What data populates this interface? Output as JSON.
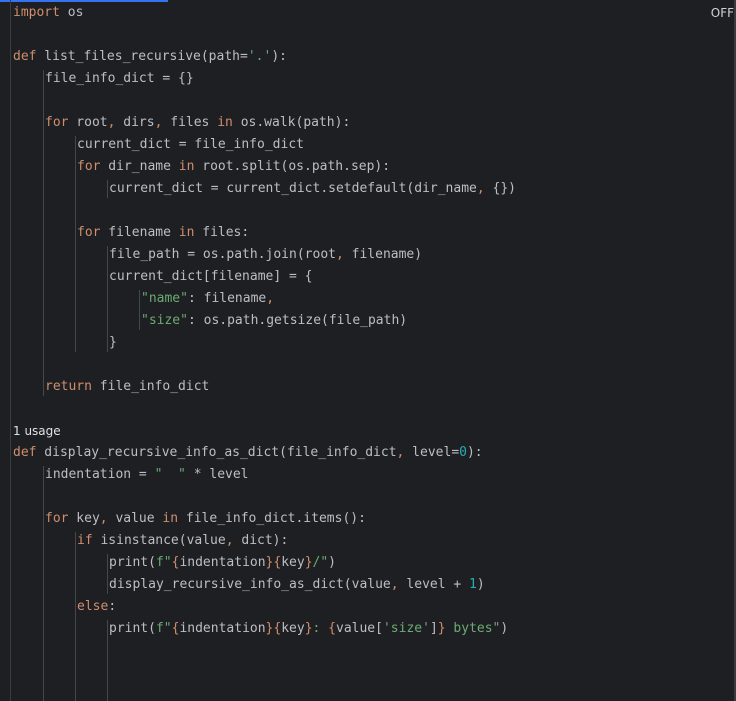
{
  "editor": {
    "badge": "OFF",
    "usage_hint": "1 usage"
  },
  "lines": [
    {
      "indent": 0,
      "tokens": [
        {
          "t": "import",
          "c": "kw"
        },
        {
          "t": " os",
          "c": "plain"
        }
      ]
    },
    {
      "indent": 0,
      "tokens": []
    },
    {
      "indent": 0,
      "tokens": [
        {
          "t": "def",
          "c": "kw"
        },
        {
          "t": " list_files_recursive",
          "c": "plain"
        },
        {
          "t": "(path=",
          "c": "plain"
        },
        {
          "t": "'.'",
          "c": "str"
        },
        {
          "t": "):",
          "c": "plain"
        }
      ]
    },
    {
      "indent": 1,
      "tokens": [
        {
          "t": "file_info_dict = {}",
          "c": "plain"
        }
      ]
    },
    {
      "indent": 0,
      "tokens": []
    },
    {
      "indent": 1,
      "tokens": [
        {
          "t": "for",
          "c": "kw"
        },
        {
          "t": " root",
          "c": "plain"
        },
        {
          "t": ",",
          "c": "kw"
        },
        {
          "t": " dirs",
          "c": "plain"
        },
        {
          "t": ",",
          "c": "kw"
        },
        {
          "t": " files ",
          "c": "plain"
        },
        {
          "t": "in",
          "c": "kw"
        },
        {
          "t": " os.walk(path):",
          "c": "plain"
        }
      ]
    },
    {
      "indent": 2,
      "tokens": [
        {
          "t": "current_dict = file_info_dict",
          "c": "plain"
        }
      ]
    },
    {
      "indent": 2,
      "tokens": [
        {
          "t": "for",
          "c": "kw"
        },
        {
          "t": " dir_name ",
          "c": "plain"
        },
        {
          "t": "in",
          "c": "kw"
        },
        {
          "t": " root.split(os.path.sep):",
          "c": "plain"
        }
      ]
    },
    {
      "indent": 3,
      "tokens": [
        {
          "t": "current_dict = current_dict.setdefault(dir_name",
          "c": "plain"
        },
        {
          "t": ",",
          "c": "kw"
        },
        {
          "t": " {})",
          "c": "plain"
        }
      ]
    },
    {
      "indent": 0,
      "tokens": []
    },
    {
      "indent": 2,
      "tokens": [
        {
          "t": "for",
          "c": "kw"
        },
        {
          "t": " filename ",
          "c": "plain"
        },
        {
          "t": "in",
          "c": "kw"
        },
        {
          "t": " files:",
          "c": "plain"
        }
      ]
    },
    {
      "indent": 3,
      "tokens": [
        {
          "t": "file_path = os.path.join(root",
          "c": "plain"
        },
        {
          "t": ",",
          "c": "kw"
        },
        {
          "t": " filename)",
          "c": "plain"
        }
      ]
    },
    {
      "indent": 3,
      "tokens": [
        {
          "t": "current_dict[filename] = {",
          "c": "plain"
        }
      ]
    },
    {
      "indent": 4,
      "tokens": [
        {
          "t": "\"name\"",
          "c": "str"
        },
        {
          "t": ": filename",
          "c": "plain"
        },
        {
          "t": ",",
          "c": "kw"
        }
      ]
    },
    {
      "indent": 4,
      "tokens": [
        {
          "t": "\"size\"",
          "c": "str"
        },
        {
          "t": ": os.path.getsize(file_path)",
          "c": "plain"
        }
      ]
    },
    {
      "indent": 3,
      "tokens": [
        {
          "t": "}",
          "c": "plain"
        }
      ]
    },
    {
      "indent": 0,
      "tokens": []
    },
    {
      "indent": 1,
      "tokens": [
        {
          "t": "return",
          "c": "kw"
        },
        {
          "t": " file_info_dict",
          "c": "plain"
        }
      ]
    },
    {
      "indent": 0,
      "tokens": []
    },
    {
      "indent": 0,
      "hint": true,
      "tokens": []
    },
    {
      "indent": 0,
      "tokens": [
        {
          "t": "def",
          "c": "kw"
        },
        {
          "t": " display_recursive_info_as_dict",
          "c": "plain"
        },
        {
          "t": "(file_info_dict",
          "c": "plain"
        },
        {
          "t": ",",
          "c": "kw"
        },
        {
          "t": " level=",
          "c": "plain"
        },
        {
          "t": "0",
          "c": "num"
        },
        {
          "t": "):",
          "c": "plain"
        }
      ]
    },
    {
      "indent": 1,
      "tokens": [
        {
          "t": "indentation = ",
          "c": "plain"
        },
        {
          "t": "\"  \"",
          "c": "str"
        },
        {
          "t": " * level",
          "c": "plain"
        }
      ]
    },
    {
      "indent": 0,
      "tokens": []
    },
    {
      "indent": 1,
      "tokens": [
        {
          "t": "for",
          "c": "kw"
        },
        {
          "t": " key",
          "c": "plain"
        },
        {
          "t": ",",
          "c": "kw"
        },
        {
          "t": " value ",
          "c": "plain"
        },
        {
          "t": "in",
          "c": "kw"
        },
        {
          "t": " file_info_dict.items():",
          "c": "plain"
        }
      ]
    },
    {
      "indent": 2,
      "tokens": [
        {
          "t": "if",
          "c": "kw"
        },
        {
          "t": " isinstance(value",
          "c": "plain"
        },
        {
          "t": ",",
          "c": "kw"
        },
        {
          "t": " dict):",
          "c": "plain"
        }
      ]
    },
    {
      "indent": 3,
      "tokens": [
        {
          "t": "print(",
          "c": "plain"
        },
        {
          "t": "f\"",
          "c": "str"
        },
        {
          "t": "{",
          "c": "kw"
        },
        {
          "t": "indentation",
          "c": "plain"
        },
        {
          "t": "}{",
          "c": "kw"
        },
        {
          "t": "key",
          "c": "plain"
        },
        {
          "t": "}",
          "c": "kw"
        },
        {
          "t": "/\"",
          "c": "str"
        },
        {
          "t": ")",
          "c": "plain"
        }
      ]
    },
    {
      "indent": 3,
      "tokens": [
        {
          "t": "display_recursive_info_as_dict(value",
          "c": "plain"
        },
        {
          "t": ",",
          "c": "kw"
        },
        {
          "t": " level + ",
          "c": "plain"
        },
        {
          "t": "1",
          "c": "num"
        },
        {
          "t": ")",
          "c": "plain"
        }
      ]
    },
    {
      "indent": 2,
      "tokens": [
        {
          "t": "else",
          "c": "kw"
        },
        {
          "t": ":",
          "c": "plain"
        }
      ]
    },
    {
      "indent": 3,
      "tokens": [
        {
          "t": "print(",
          "c": "plain"
        },
        {
          "t": "f\"",
          "c": "str"
        },
        {
          "t": "{",
          "c": "kw"
        },
        {
          "t": "indentation",
          "c": "plain"
        },
        {
          "t": "}{",
          "c": "kw"
        },
        {
          "t": "key",
          "c": "plain"
        },
        {
          "t": "}",
          "c": "kw"
        },
        {
          "t": ": ",
          "c": "str"
        },
        {
          "t": "{",
          "c": "kw"
        },
        {
          "t": "value[",
          "c": "plain"
        },
        {
          "t": "'size'",
          "c": "str"
        },
        {
          "t": "]",
          "c": "plain"
        },
        {
          "t": "}",
          "c": "kw"
        },
        {
          "t": " bytes\"",
          "c": "str"
        },
        {
          "t": ")",
          "c": "plain"
        }
      ]
    }
  ]
}
